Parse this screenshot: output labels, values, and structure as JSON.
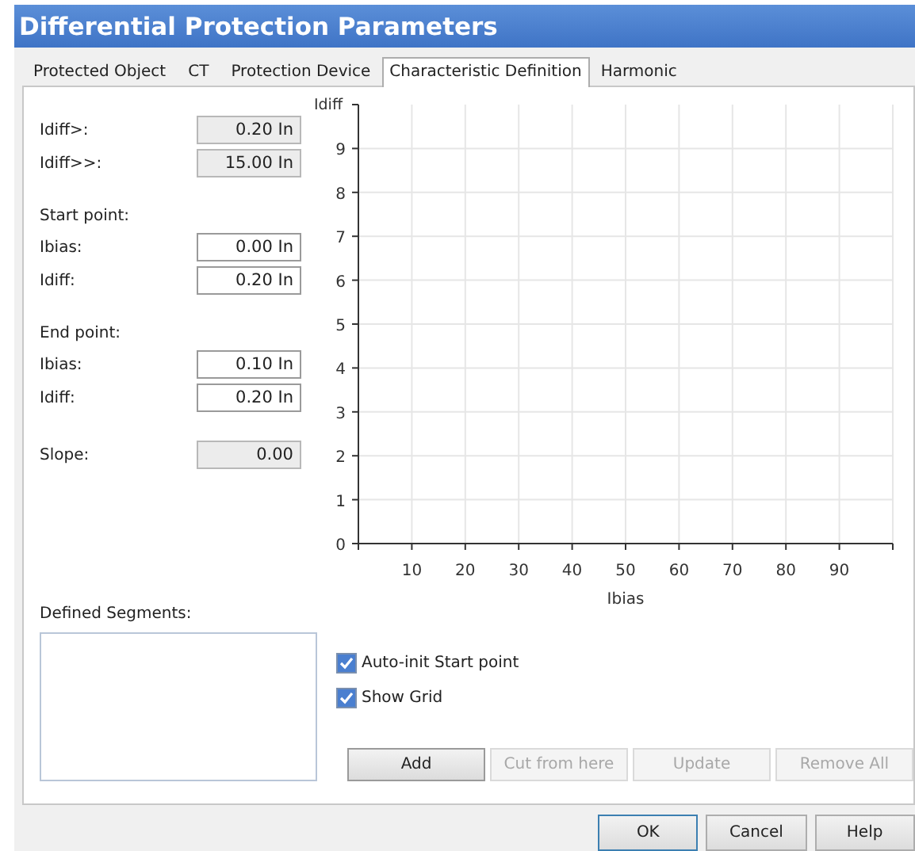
{
  "window": {
    "title": "Differential Protection Parameters"
  },
  "tabs": [
    {
      "label": "Protected Object",
      "selected": false
    },
    {
      "label": "CT",
      "selected": false
    },
    {
      "label": "Protection Device",
      "selected": false
    },
    {
      "label": "Characteristic Definition",
      "selected": true
    },
    {
      "label": "Harmonic",
      "selected": false
    }
  ],
  "groups": [
    {
      "fields": [
        {
          "label": "Idiff>:",
          "value": "0.20 In",
          "disabled": true
        },
        {
          "label": "Idiff>>:",
          "value": "15.00 In",
          "disabled": true
        }
      ]
    },
    {
      "heading": "Start point:",
      "fields": [
        {
          "label": "Ibias:",
          "value": "0.00 In",
          "disabled": false
        },
        {
          "label": "Idiff:",
          "value": "0.20 In",
          "disabled": false
        }
      ]
    },
    {
      "heading": "End point:",
      "fields": [
        {
          "label": "Ibias:",
          "value": "0.10 In",
          "disabled": false
        },
        {
          "label": "Idiff:",
          "value": "0.20 In",
          "disabled": false
        }
      ]
    },
    {
      "fields": [
        {
          "label": "Slope:",
          "value": "0.00",
          "disabled": true
        }
      ]
    }
  ],
  "chart": {
    "chart_data": {
      "type": "line",
      "xlabel": "Ibias",
      "ylabel": "Idiff",
      "xlim": [
        0,
        100
      ],
      "ylim": [
        0,
        10
      ],
      "xticks": [
        10,
        20,
        30,
        40,
        50,
        60,
        70,
        80,
        90
      ],
      "yticks": [
        0,
        1,
        2,
        3,
        4,
        5,
        6,
        7,
        8,
        9
      ],
      "grid": true
    }
  },
  "segments": {
    "label": "Defined Segments:"
  },
  "options": [
    {
      "label": "Auto-init Start point",
      "checked": true
    },
    {
      "label": "Show Grid",
      "checked": true
    }
  ],
  "segment_buttons": [
    {
      "label": "Add",
      "disabled": false
    },
    {
      "label": "Cut from here",
      "disabled": true
    },
    {
      "label": "Update",
      "disabled": true
    },
    {
      "label": "Remove All",
      "disabled": true
    }
  ],
  "dialog_buttons": [
    {
      "label": "OK",
      "default": true
    },
    {
      "label": "Cancel",
      "default": false
    },
    {
      "label": "Help",
      "default": false
    }
  ]
}
